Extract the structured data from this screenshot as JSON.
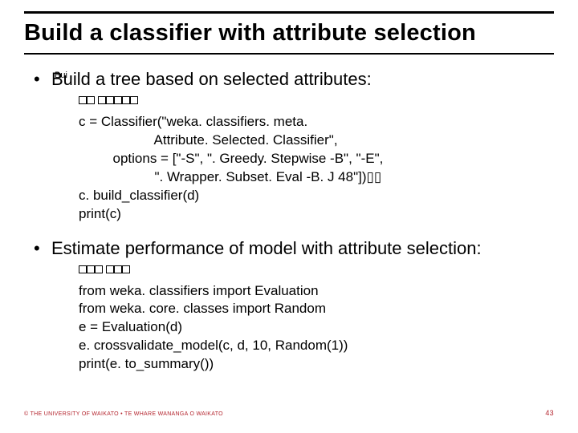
{
  "title": "Build a classifier with attribute selection",
  "bullets": [
    {
      "label": "Build a tree based on selected attributes:",
      "overlay": "Bui",
      "code_overlay": "c = Classifi",
      "code": "c = Classifier(\"weka. classifiers. meta.\n                    Attribute. Selected. Classifier\",\n         options = [\"-S\", \". Greedy. Stepwise -B\", \"-E\",\n                    \". Wrapper. Subset. Eval -B. J 48\"])▯▯\nc. build_classifier(d)\nprint(c)"
    },
    {
      "label": "Estimate performance of model with attribute selection:",
      "overlay": "",
      "code_overlay": "from wek",
      "code": "from weka. classifiers import Evaluation\nfrom weka. core. classes import Random\ne = Evaluation(d)\ne. crossvalidate_model(c, d, 10, Random(1))\nprint(e. to_summary())"
    }
  ],
  "footer_left": "© THE UNIVERSITY OF WAIKATO  •  TE WHARE WANANGA O WAIKATO",
  "page_number": "43"
}
